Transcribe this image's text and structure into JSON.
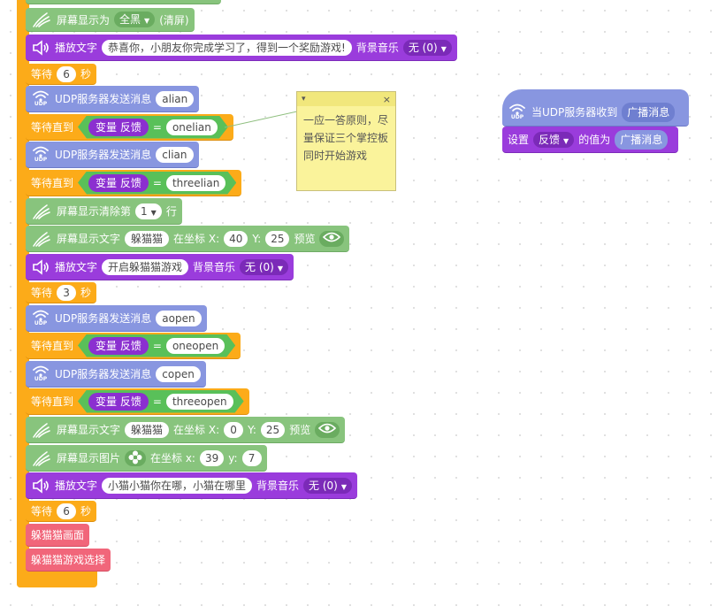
{
  "blocks": {
    "screen_show": {
      "label": "屏幕显示为",
      "option": "全黑",
      "suffix": "(清屏)"
    },
    "play1": {
      "label": "播放文字",
      "text": "恭喜你，小朋友你完成学习了，得到一个奖励游戏!",
      "bg": "背景音乐",
      "bg_option": "无 (0)"
    },
    "wait1": {
      "label": "等待",
      "value": "6",
      "unit": "秒"
    },
    "udp1": {
      "label": "UDP服务器发送消息",
      "msg": "alian"
    },
    "until1": {
      "label": "等待直到",
      "var_label": "变量",
      "var_name": "反馈",
      "eq": "=",
      "value": "onelian"
    },
    "udp2": {
      "label": "UDP服务器发送消息",
      "msg": "clian"
    },
    "until2": {
      "label": "等待直到",
      "var_label": "变量",
      "var_name": "反馈",
      "eq": "=",
      "value": "threelian"
    },
    "clear_line": {
      "label": "屏幕显示清除第",
      "option": "1",
      "suffix": "行"
    },
    "show_text1": {
      "label": "屏幕显示文字",
      "text": "躲猫猫",
      "at": "在坐标 X:",
      "x": "40",
      "ylabel": "Y:",
      "y": "25",
      "preview": "预览"
    },
    "play2": {
      "label": "播放文字",
      "text": "开启躲猫猫游戏",
      "bg": "背景音乐",
      "bg_option": "无 (0)"
    },
    "wait2": {
      "label": "等待",
      "value": "3",
      "unit": "秒"
    },
    "udp3": {
      "label": "UDP服务器发送消息",
      "msg": "aopen"
    },
    "until3": {
      "label": "等待直到",
      "var_label": "变量",
      "var_name": "反馈",
      "eq": "=",
      "value": "oneopen"
    },
    "udp4": {
      "label": "UDP服务器发送消息",
      "msg": "copen"
    },
    "until4": {
      "label": "等待直到",
      "var_label": "变量",
      "var_name": "反馈",
      "eq": "=",
      "value": "threeopen"
    },
    "show_text2": {
      "label": "屏幕显示文字",
      "text": "躲猫猫",
      "at": "在坐标 X:",
      "x": "0",
      "ylabel": "Y:",
      "y": "25",
      "preview": "预览"
    },
    "show_image": {
      "label": "屏幕显示图片",
      "at": "在坐标 x:",
      "x": "39",
      "ylabel": "y:",
      "y": "7"
    },
    "play3": {
      "label": "播放文字",
      "text": "小猫小猫你在哪，小猫在哪里",
      "bg": "背景音乐",
      "bg_option": "无 (0)"
    },
    "wait3": {
      "label": "等待",
      "value": "6",
      "unit": "秒"
    },
    "proc1": {
      "label": "躲猫猫画面"
    },
    "proc2": {
      "label": "躲猫猫游戏选择"
    }
  },
  "event": {
    "hat_label": "当UDP服务器收到",
    "hat_value": "广播消息",
    "set_label": "设置",
    "set_var": "反馈",
    "set_mid": "的值为",
    "set_value": "广播消息"
  },
  "note": {
    "text": "一应一答原则，尽量保证三个掌控板同时开始游戏",
    "close": "×",
    "collapse": "▾"
  },
  "icons": {
    "udp_badge": "UDP"
  },
  "colors": {
    "control": "#fcab19",
    "display": "#88c47d",
    "audio": "#9a3cdc",
    "network": "#8896e0",
    "procedure": "#f1667a",
    "operator": "#59c059"
  }
}
